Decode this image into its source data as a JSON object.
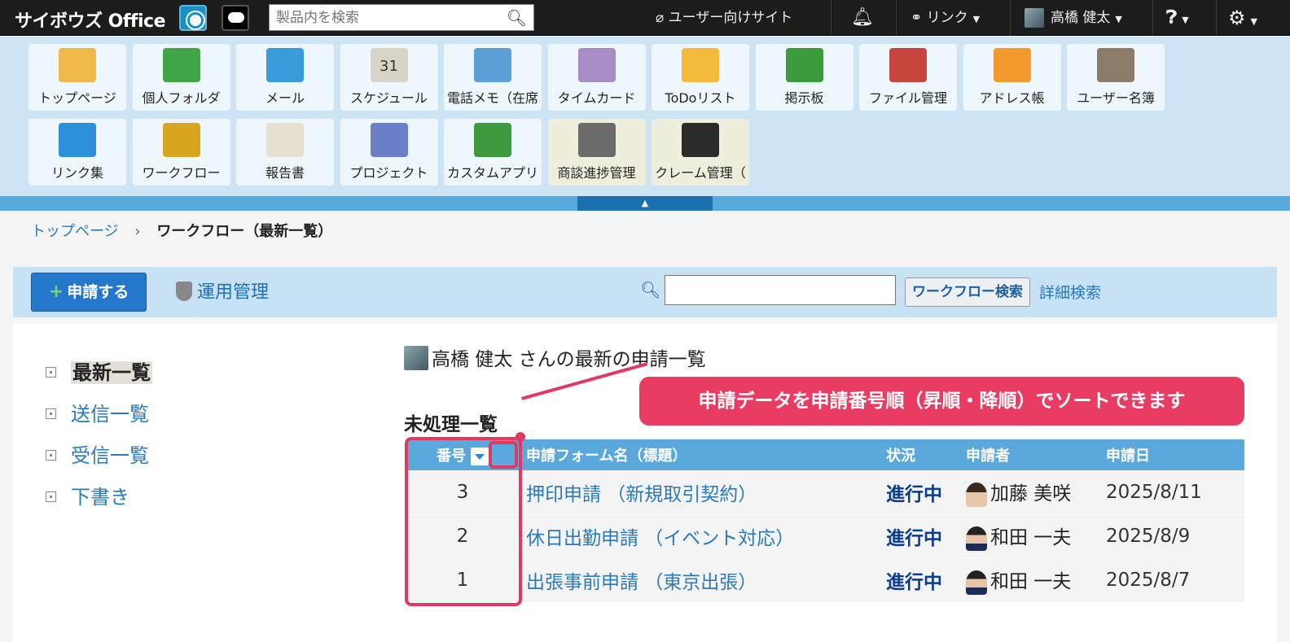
{
  "topbar": {
    "brand": "サイボウズ Office",
    "search_placeholder": "製品内を検索",
    "user_site": "ユーザー向けサイト",
    "link_menu": "リンク",
    "user_name": "高橋 健太"
  },
  "apps": [
    {
      "label": "トップページ",
      "icon": "house-icon"
    },
    {
      "label": "個人フォルダ",
      "icon": "folder-icon"
    },
    {
      "label": "メール",
      "icon": "mail-icon"
    },
    {
      "label": "スケジュール",
      "icon": "calendar-icon",
      "day": "31"
    },
    {
      "label": "電話メモ（在席",
      "icon": "phone-icon"
    },
    {
      "label": "タイムカード",
      "icon": "timecard-icon"
    },
    {
      "label": "ToDoリスト",
      "icon": "todo-icon"
    },
    {
      "label": "掲示板",
      "icon": "board-icon"
    },
    {
      "label": "ファイル管理",
      "icon": "binder-icon"
    },
    {
      "label": "アドレス帳",
      "icon": "addressbook-icon"
    },
    {
      "label": "ユーザー名簿",
      "icon": "userbook-icon"
    },
    {
      "label": "リンク集",
      "icon": "globe-icon"
    },
    {
      "label": "ワークフロー",
      "icon": "stamp-icon"
    },
    {
      "label": "報告書",
      "icon": "report-icon"
    },
    {
      "label": "プロジェクト",
      "icon": "project-icon"
    },
    {
      "label": "カスタムアプリ",
      "icon": "blocks-icon"
    },
    {
      "label": "商談進捗管理",
      "icon": "briefcase-icon"
    },
    {
      "label": "クレーム管理（",
      "icon": "headset-icon"
    }
  ],
  "breadcrumb": {
    "home": "トップページ",
    "current": "ワークフロー（最新一覧）"
  },
  "toolbar": {
    "apply_label": "申請する",
    "admin_label": "運用管理",
    "search_button": "ワークフロー検索",
    "detail_search": "詳細検索"
  },
  "sidebar": {
    "items": [
      {
        "label": "最新一覧"
      },
      {
        "label": "送信一覧"
      },
      {
        "label": "受信一覧"
      },
      {
        "label": "下書き"
      }
    ]
  },
  "main": {
    "list_title": "高橋 健太 さんの最新の申請一覧",
    "section_title": "未処理一覧",
    "columns": {
      "num": "番号",
      "form": "申請フォーム名（標題）",
      "status": "状況",
      "applicant": "申請者",
      "date": "申請日"
    },
    "rows": [
      {
        "num": "3",
        "form": "押印申請 （新規取引契約）",
        "status": "進行中",
        "applicant": "加藤 美咲",
        "date": "2025/8/11"
      },
      {
        "num": "2",
        "form": "休日出勤申請 （イベント対応）",
        "status": "進行中",
        "applicant": "和田 一夫",
        "date": "2025/8/9"
      },
      {
        "num": "1",
        "form": "出張事前申請 （東京出張）",
        "status": "進行中",
        "applicant": "和田 一夫",
        "date": "2025/8/7"
      }
    ]
  },
  "annotation": {
    "callout": "申請データを申請番号順（昇順・降順）でソートできます"
  },
  "colors": {
    "accent": "#2478cb",
    "header_blue": "#5aa8dc",
    "highlight": "#e03a62",
    "launcher_bg": "#cce4f4"
  }
}
